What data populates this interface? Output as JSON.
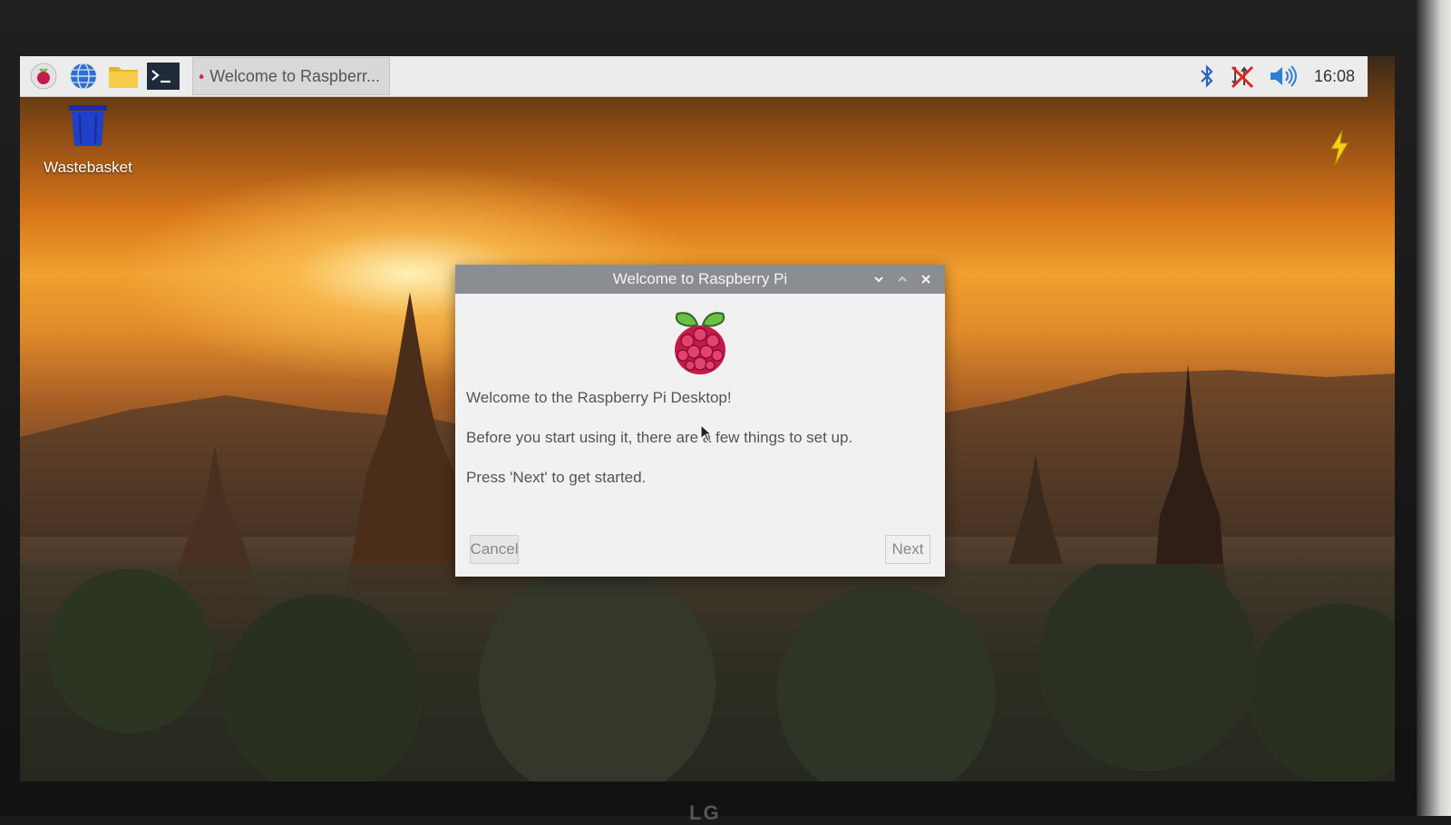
{
  "taskbar": {
    "launchers": [
      "raspberry-menu",
      "web-browser",
      "file-manager",
      "terminal"
    ],
    "task": {
      "label": "Welcome to Raspberr..."
    },
    "clock": "16:08"
  },
  "desktop": {
    "icons": [
      {
        "label": "Wastebasket"
      }
    ]
  },
  "dialog": {
    "title": "Welcome to Raspberry Pi",
    "line1": "Welcome to the Raspberry Pi Desktop!",
    "line2": "Before you start using it, there are a few things to set up.",
    "line3": "Press 'Next' to get started.",
    "cancel_label": "Cancel",
    "next_label": "Next"
  },
  "bezel": {
    "brand": "LG"
  },
  "colors": {
    "taskbar_bg": "#ececec",
    "dialog_title_bg": "#8a8d92",
    "dialog_bg": "#f1f1f1",
    "raspberry_red": "#c51a4a",
    "leaf_green": "#6cc04a",
    "folder_yellow": "#f1c232",
    "volume_blue": "#2f7fd1"
  }
}
